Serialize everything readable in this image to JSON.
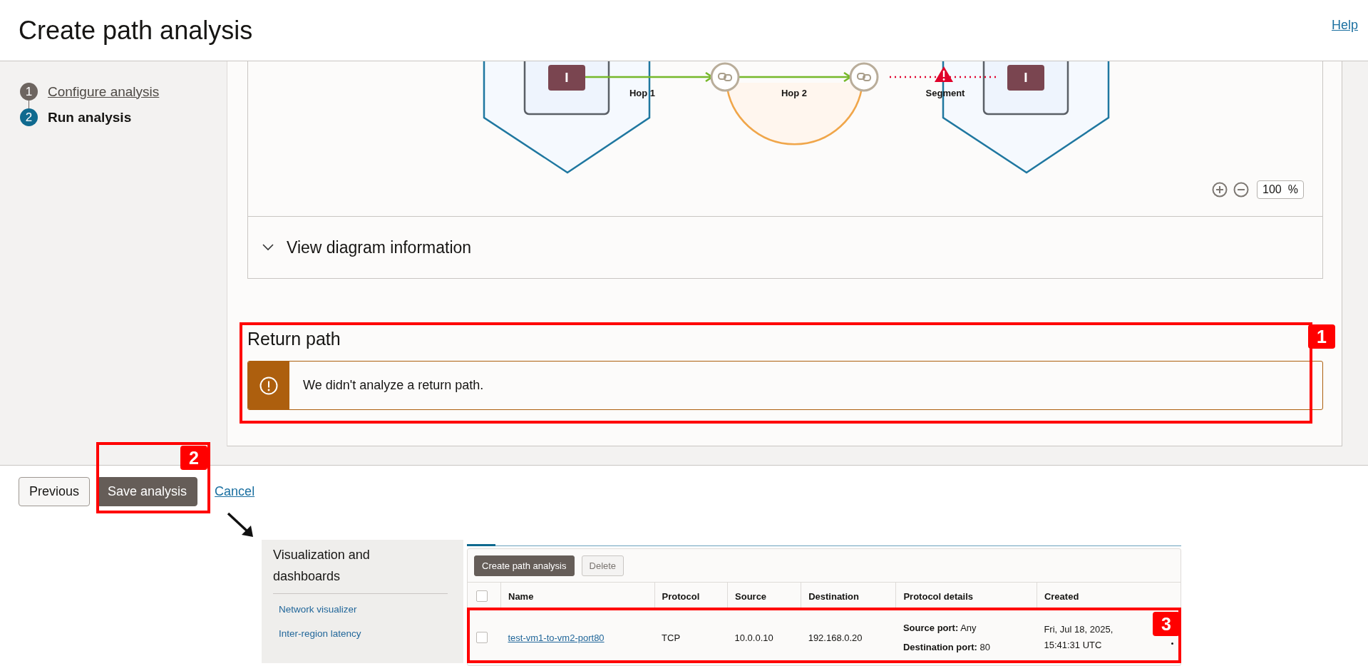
{
  "page": {
    "title": "Create path analysis",
    "help_link": "Help"
  },
  "steps": [
    {
      "number": "1",
      "label": "Configure analysis",
      "selected": false
    },
    {
      "number": "2",
      "label": "Run analysis",
      "selected": true
    }
  ],
  "diagram": {
    "instances": [
      {
        "label": "I"
      },
      {
        "label": "I"
      }
    ],
    "links": [
      {
        "label": "Hop 1",
        "kind": "ok"
      },
      {
        "label": "Hop 2",
        "kind": "ok"
      },
      {
        "label": "Segment",
        "kind": "error"
      }
    ],
    "zoom": {
      "value": "100",
      "unit": "%"
    }
  },
  "diagram_info": {
    "label": "View diagram information",
    "expanded": false
  },
  "return_path": {
    "title": "Return path",
    "message": "We didn't analyze a return path."
  },
  "footer": {
    "buttons": [
      {
        "label": "Previous",
        "kind": "secondary"
      },
      {
        "label": "Save analysis",
        "kind": "primary"
      },
      {
        "label": "Cancel",
        "kind": "link"
      }
    ]
  },
  "callouts": [
    {
      "number": "1"
    },
    {
      "number": "2"
    },
    {
      "number": "3"
    }
  ],
  "inset": {
    "sidebar": {
      "title": "Visualization and dashboards",
      "links": [
        "Network visualizer",
        "Inter-region latency"
      ]
    },
    "toolbar": [
      {
        "label": "Create path analysis",
        "disabled": false
      },
      {
        "label": "Delete",
        "disabled": true
      }
    ],
    "table": {
      "select_all": {
        "checked": false
      },
      "columns": [
        "Name",
        "Protocol",
        "Source",
        "Destination",
        "Protocol details",
        "Created"
      ],
      "rows": [
        {
          "selected": false,
          "name": "test-vm1-to-vm2-port80",
          "protocol": "TCP",
          "source": "10.0.0.10",
          "destination": "192.168.0.20",
          "details": [
            "**Source port:** Any",
            "**Destination port:** 80"
          ],
          "created": "Fri, Jul 18, 2025, 15:41:31 UTC"
        }
      ]
    }
  }
}
